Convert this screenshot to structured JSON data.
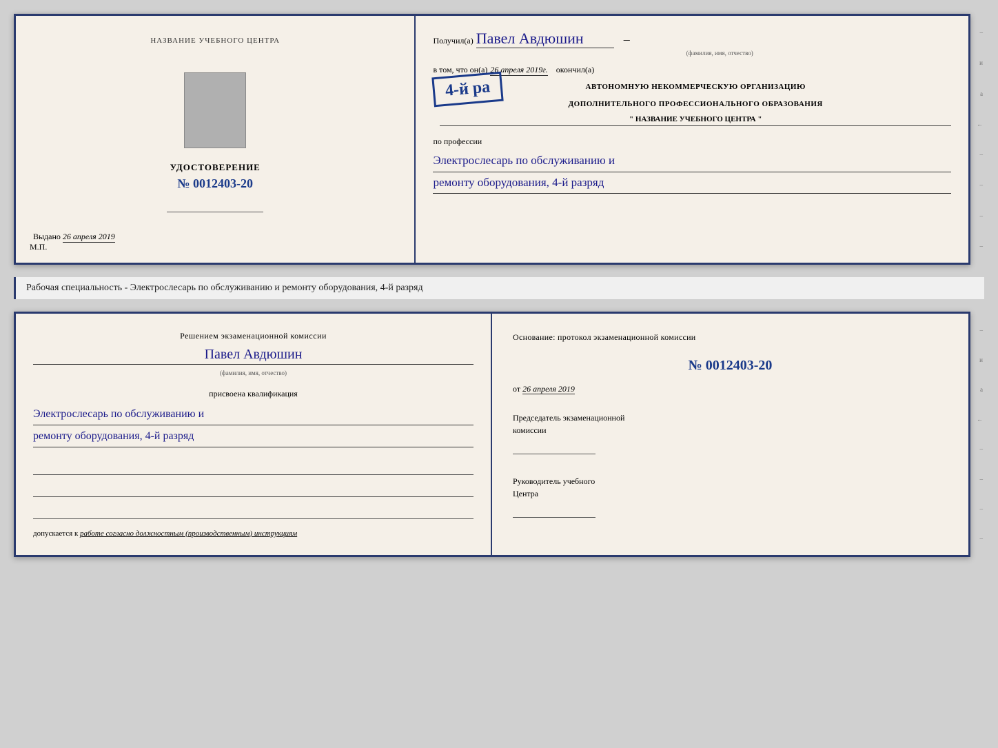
{
  "top_doc": {
    "left_panel": {
      "title": "НАЗВАНИЕ УЧЕБНОГО ЦЕНТРА",
      "photo_alt": "фото",
      "udostoverenie_label": "УДОСТОВЕРЕНИЕ",
      "number_prefix": "№",
      "number": "0012403-20",
      "issued_prefix": "Выдано",
      "issued_date": "26 апреля 2019",
      "mp_label": "М.П."
    },
    "right_panel": {
      "received_prefix": "Получил(а)",
      "recipient_name": "Павел Авдюшин",
      "fio_label": "(фамилия, имя, отчество)",
      "vtom_prefix": "в том, что он(а)",
      "vtom_date": "26 апреля 2019г.",
      "okonchil": "окончил(а)",
      "rank_stamp": "4-й ра",
      "org_line1": "АВТОНОМНУЮ НЕКОММЕРЧЕСКУЮ ОРГАНИЗАЦИЮ",
      "org_line2": "ДОПОЛНИТЕЛЬНОГО ПРОФЕССИОНАЛЬНОГО ОБРАЗОВАНИЯ",
      "org_name": "\" НАЗВАНИЕ УЧЕБНОГО ЦЕНТРА \"",
      "po_professii": "по профессии",
      "profession_line1": "Электрослесарь по обслуживанию и",
      "profession_line2": "ремонту оборудования, 4-й разряд"
    }
  },
  "middle_section": {
    "text": "Рабочая специальность - Электрослесарь по обслуживанию и ремонту оборудования, 4-й разряд"
  },
  "bottom_doc": {
    "left_panel": {
      "resheniem_text": "Решением экзаменационной комиссии",
      "name_handwritten": "Павел Авдюшин",
      "fio_label": "(фамилия, имя, отчество)",
      "prisvoena_text": "присвоена квалификация",
      "qual_line1": "Электрослесарь по обслуживанию и",
      "qual_line2": "ремонту оборудования, 4-й разряд",
      "dopuskaetsya_prefix": "допускается к",
      "dopuskaetsya_text": "работе согласно должностным (производственным) инструкциям"
    },
    "right_panel": {
      "osnovanie_text": "Основание: протокол экзаменационной комиссии",
      "number_prefix": "№",
      "protocol_number": "0012403-20",
      "ot_prefix": "от",
      "ot_date": "26 апреля 2019",
      "predsedatel_line1": "Председатель экзаменационной",
      "predsedatel_line2": "комиссии",
      "rukovoditel_line1": "Руководитель учебного",
      "rukovoditel_line2": "Центра"
    }
  },
  "right_labels": [
    "и",
    "а",
    "←",
    "–",
    "–",
    "–",
    "–",
    "–"
  ],
  "colors": {
    "border": "#2a3a6e",
    "handwriting": "#1a1a8a",
    "stamp_blue": "#1a3a8a",
    "background": "#f5f0e8"
  }
}
